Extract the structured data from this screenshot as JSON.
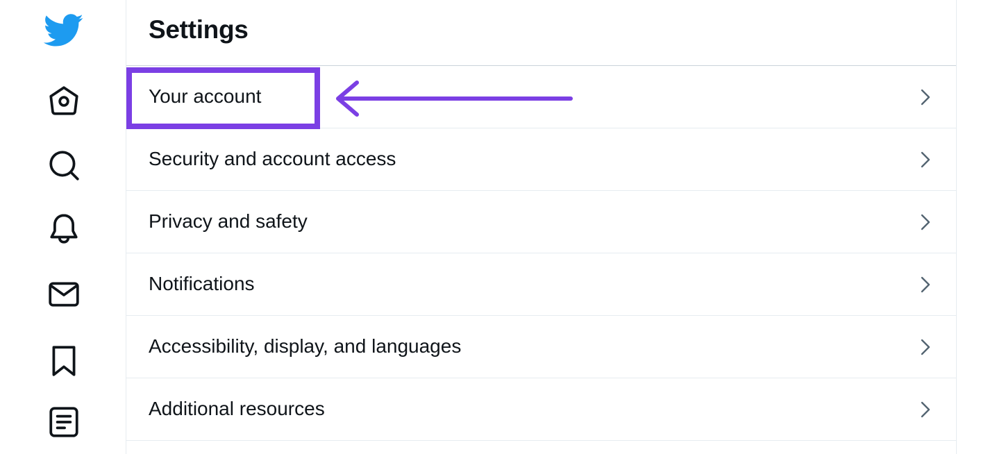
{
  "nav": {
    "items": [
      {
        "icon": "twitter-bird-icon"
      },
      {
        "icon": "home-icon"
      },
      {
        "icon": "search-icon"
      },
      {
        "icon": "bell-icon"
      },
      {
        "icon": "mail-icon"
      },
      {
        "icon": "bookmark-icon"
      },
      {
        "icon": "list-icon"
      }
    ]
  },
  "header": {
    "title": "Settings"
  },
  "settings": {
    "items": [
      {
        "label": "Your account"
      },
      {
        "label": "Security and account access"
      },
      {
        "label": "Privacy and safety"
      },
      {
        "label": "Notifications"
      },
      {
        "label": "Accessibility, display, and languages"
      },
      {
        "label": "Additional resources"
      }
    ]
  },
  "colors": {
    "brand": "#1d9bf0",
    "annotation": "#7b3fe4",
    "text": "#0f1419",
    "chevron": "#536471",
    "divider": "#e6ecf0"
  }
}
